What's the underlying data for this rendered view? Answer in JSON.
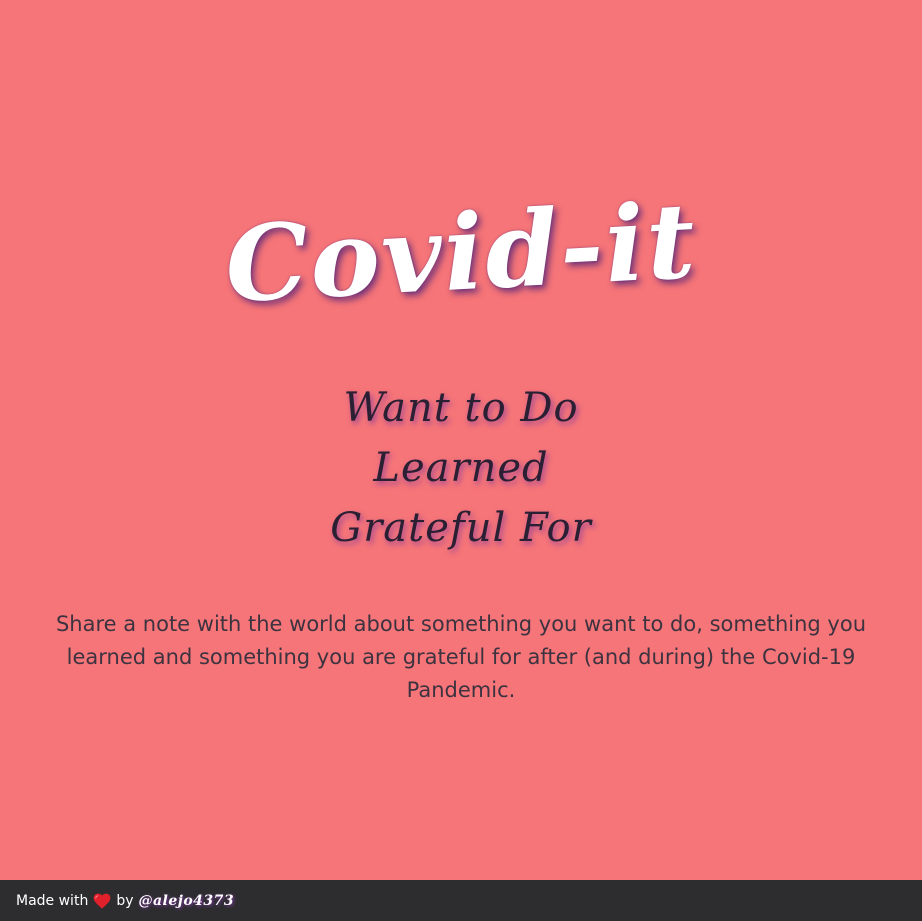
{
  "hero": {
    "title": "Covid-it",
    "subtitles": [
      "Want to Do",
      "Learned",
      "Grateful For"
    ],
    "description": "Share a note with the world about something you want to do, something you learned and something you are grateful for after (and during) the Covid-19 Pandemic."
  },
  "footer": {
    "made_with": "Made with",
    "heart_icon": "heart-icon",
    "by": "by",
    "author": "@alejo4373"
  },
  "colors": {
    "background": "#f67578",
    "footer": "#2d2d2f",
    "heart": "#e0202a"
  }
}
